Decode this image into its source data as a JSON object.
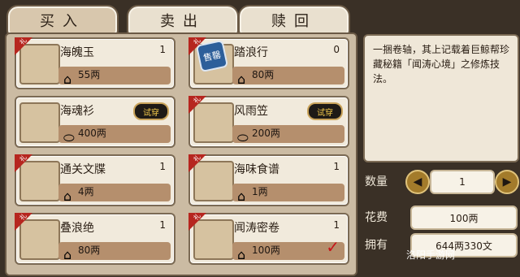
{
  "tabs": [
    {
      "label": "买入"
    },
    {
      "label": "卖出"
    },
    {
      "label": "赎回"
    }
  ],
  "items": [
    {
      "name": "海魄玉",
      "qty": "1",
      "price": "55两",
      "badge": "",
      "ribbon": "礼"
    },
    {
      "name": "踏浪行",
      "qty": "0",
      "price": "80两",
      "badge": "售罄",
      "ribbon": "礼"
    },
    {
      "name": "海魂衫",
      "qty": "1",
      "price": "400两",
      "badge": "试穿",
      "ribbon": ""
    },
    {
      "name": "风雨笠",
      "qty": "1",
      "price": "200两",
      "badge": "试穿",
      "ribbon": "礼"
    },
    {
      "name": "通关文牒",
      "qty": "1",
      "price": "4两",
      "badge": "",
      "ribbon": "礼"
    },
    {
      "name": "海味食谱",
      "qty": "1",
      "price": "1两",
      "badge": "",
      "ribbon": "礼"
    },
    {
      "name": "叠浪绝",
      "qty": "1",
      "price": "80两",
      "badge": "",
      "ribbon": "礼"
    },
    {
      "name": "闻涛密卷",
      "qty": "1",
      "price": "100两",
      "badge": "",
      "ribbon": "礼"
    }
  ],
  "description": "一捆卷轴，其上记载着巨鲸帮珍藏秘籍「闻涛心境」之修炼技法。",
  "controls": {
    "quantity_label": "数量",
    "quantity_value": "1",
    "cost_label": "花费",
    "cost_value": "100两",
    "owned_label": "拥有",
    "owned_value": "644两330文"
  },
  "watermark": "洛阳手游网"
}
